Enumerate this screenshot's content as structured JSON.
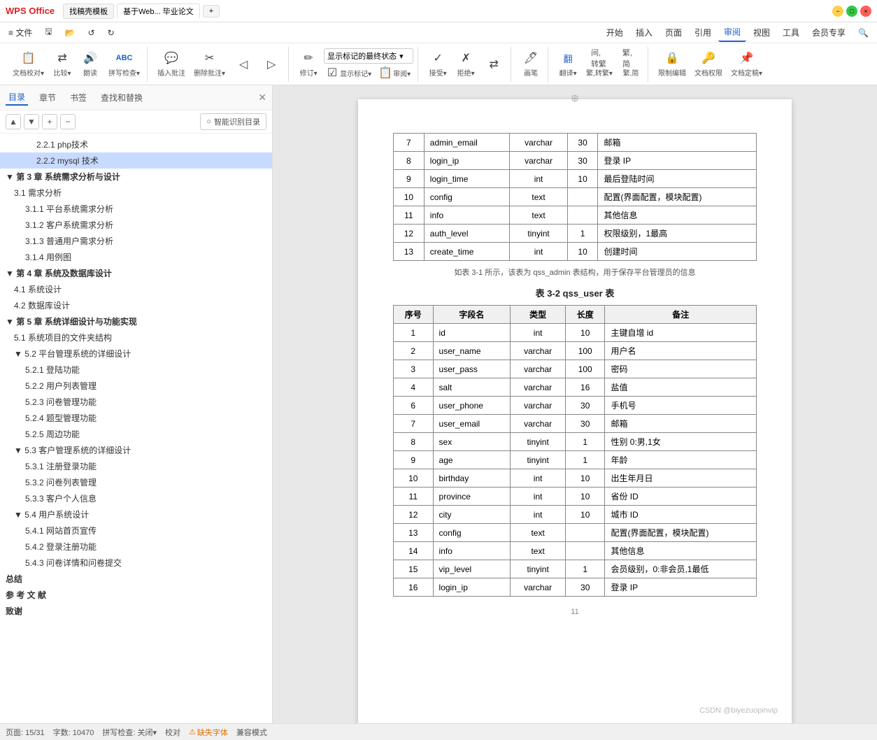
{
  "titleBar": {
    "wpsLabel": "WPS Office",
    "tabs": [
      {
        "label": "找稿壳模板",
        "active": false
      },
      {
        "label": "基于Web... 毕业论文",
        "active": true
      }
    ],
    "addTabLabel": "+",
    "moreLabel": "···"
  },
  "menuBar": {
    "items": [
      {
        "label": "≡ 文件",
        "active": false
      },
      {
        "label": "日",
        "active": false
      },
      {
        "label": "↺",
        "active": false
      },
      {
        "label": "✏",
        "active": false
      },
      {
        "label": "◁",
        "active": false
      },
      {
        "label": "▷",
        "active": false
      },
      {
        "label": "开始",
        "active": false
      },
      {
        "label": "插入",
        "active": false
      },
      {
        "label": "页面",
        "active": false
      },
      {
        "label": "引用",
        "active": false
      },
      {
        "label": "审阅",
        "active": true
      },
      {
        "label": "视图",
        "active": false
      },
      {
        "label": "工具",
        "active": false
      },
      {
        "label": "会员专享",
        "active": false
      },
      {
        "label": "🔍",
        "active": false
      }
    ]
  },
  "toolbar": {
    "groups": [
      {
        "name": "review-group1",
        "buttons": [
          {
            "id": "doc-check",
            "icon": "📋",
            "label": "文档校对▾"
          },
          {
            "id": "compare",
            "icon": "⇄",
            "label": "比较▾"
          },
          {
            "id": "read-aloud",
            "icon": "🔊",
            "label": "朗读"
          },
          {
            "id": "spell-check",
            "icon": "ABC",
            "label": "拼写检查▾"
          }
        ]
      },
      {
        "name": "comment-group",
        "buttons": [
          {
            "id": "insert-comment",
            "icon": "💬",
            "label": "插入批注"
          },
          {
            "id": "delete-comment",
            "icon": "🗑",
            "label": "删除批注▾"
          },
          {
            "id": "nav-comment",
            "icon": "◁▷",
            "label": ""
          }
        ]
      },
      {
        "name": "track-group",
        "buttons": [
          {
            "id": "track-changes",
            "icon": "✏",
            "label": "修订▾"
          },
          {
            "id": "display-mode",
            "icon": "",
            "label": "显示标记的最终状态▾",
            "isDropdown": true
          },
          {
            "id": "show-markup",
            "icon": "☑",
            "label": "显示标记▾"
          },
          {
            "id": "review-pane",
            "icon": "📋",
            "label": "审阅▾"
          }
        ]
      },
      {
        "name": "accept-group",
        "buttons": [
          {
            "id": "accept",
            "icon": "✓",
            "label": "接受▾"
          },
          {
            "id": "reject",
            "icon": "✗",
            "label": "拒绝▾"
          },
          {
            "id": "compare2",
            "icon": "⇄",
            "label": ""
          }
        ]
      },
      {
        "name": "paint-group",
        "buttons": [
          {
            "id": "paint-brush",
            "icon": "🖊",
            "label": "画笔"
          }
        ]
      },
      {
        "name": "translate-group",
        "buttons": [
          {
            "id": "translate",
            "icon": "翻",
            "label": "翻译▾"
          },
          {
            "id": "trad-simp",
            "icon": "繁",
            "label": "繁,转繁▾"
          },
          {
            "id": "simp",
            "icon": "简",
            "label": "繁,简"
          }
        ]
      },
      {
        "name": "restrict-group",
        "buttons": [
          {
            "id": "restrict-edit",
            "icon": "🔒",
            "label": "限制编辑"
          },
          {
            "id": "doc-permission",
            "icon": "🔑",
            "label": "文档权限"
          },
          {
            "id": "doc-finalize",
            "icon": "📌",
            "label": "文档定稿▾"
          }
        ]
      }
    ]
  },
  "toc": {
    "tabs": [
      "目录",
      "章节",
      "书签",
      "查找和替换"
    ],
    "activeTab": "目录",
    "controls": [
      "▲",
      "▼",
      "+",
      "−"
    ],
    "smartTocLabel": "智能识别目录",
    "items": [
      {
        "label": "2.2.1 php技术",
        "level": 4,
        "selected": false
      },
      {
        "label": "2.2.2 mysql 技术",
        "level": 4,
        "selected": true
      },
      {
        "label": "第 3 章 系统需求分析与设计",
        "level": 1,
        "selected": false
      },
      {
        "label": "3.1 需求分析",
        "level": 2,
        "selected": false
      },
      {
        "label": "3.1.1 平台系统需求分析",
        "level": 3,
        "selected": false
      },
      {
        "label": "3.1.2 客户系统需求分析",
        "level": 3,
        "selected": false
      },
      {
        "label": "3.1.3 普通用户需求分析",
        "level": 3,
        "selected": false
      },
      {
        "label": "3.1.4 用例图",
        "level": 3,
        "selected": false
      },
      {
        "label": "第 4 章 系统及数据库设计",
        "level": 1,
        "selected": false
      },
      {
        "label": "4.1 系统设计",
        "level": 2,
        "selected": false
      },
      {
        "label": "4.2 数据库设计",
        "level": 2,
        "selected": false
      },
      {
        "label": "第 5 章 系统详细设计与功能实现",
        "level": 1,
        "selected": false
      },
      {
        "label": "5.1  系统项目的文件夹结构",
        "level": 2,
        "selected": false
      },
      {
        "label": "5.2 平台管理系统的详细设计",
        "level": 2,
        "selected": false
      },
      {
        "label": "5.2.1 登陆功能",
        "level": 3,
        "selected": false
      },
      {
        "label": "5.2.2 用户列表管理",
        "level": 3,
        "selected": false
      },
      {
        "label": "5.2.3 问卷管理功能",
        "level": 3,
        "selected": false
      },
      {
        "label": "5.2.4 题型管理功能",
        "level": 3,
        "selected": false
      },
      {
        "label": "5.2.5 周边功能",
        "level": 3,
        "selected": false
      },
      {
        "label": "5.3 客户管理系统的详细设计",
        "level": 2,
        "selected": false
      },
      {
        "label": "5.3.1 注册登录功能",
        "level": 3,
        "selected": false
      },
      {
        "label": "5.3.2 问卷列表管理",
        "level": 3,
        "selected": false
      },
      {
        "label": "5.3.3 客户个人信息",
        "level": 3,
        "selected": false
      },
      {
        "label": "5.4 用户系统设计",
        "level": 2,
        "selected": false
      },
      {
        "label": "5.4.1 网站首页宣传",
        "level": 3,
        "selected": false
      },
      {
        "label": "5.4.2 登录注册功能",
        "level": 3,
        "selected": false
      },
      {
        "label": "5.4.3 问卷详情和问卷提交",
        "level": 3,
        "selected": false
      },
      {
        "label": "总结",
        "level": 1,
        "selected": false
      },
      {
        "label": "参 考 文 献",
        "level": 1,
        "selected": false
      },
      {
        "label": "致谢",
        "level": 1,
        "selected": false
      }
    ]
  },
  "document": {
    "table1": {
      "rows": [
        {
          "seq": "7",
          "field": "admin_email",
          "type": "varchar",
          "length": "30",
          "note": "邮箱"
        },
        {
          "seq": "8",
          "field": "login_ip",
          "type": "varchar",
          "length": "30",
          "note": "登录 IP"
        },
        {
          "seq": "9",
          "field": "login_time",
          "type": "int",
          "length": "10",
          "note": "最后登陆时间"
        },
        {
          "seq": "10",
          "field": "config",
          "type": "text",
          "length": "",
          "note": "配置(界面配置，模块配置)"
        },
        {
          "seq": "11",
          "field": "info",
          "type": "text",
          "length": "",
          "note": "其他信息"
        },
        {
          "seq": "12",
          "field": "auth_level",
          "type": "tinyint",
          "length": "1",
          "note": "权限级别，1最高"
        },
        {
          "seq": "13",
          "field": "create_time",
          "type": "int",
          "length": "10",
          "note": "创建时间"
        }
      ],
      "note": "如表 3-1 所示，该表为 qss_admin 表结构，用于保存平台管理员的信息"
    },
    "table2": {
      "caption": "表 3-2  qss_user 表",
      "headers": [
        "序号",
        "字段名",
        "类型",
        "长度",
        "备注"
      ],
      "rows": [
        {
          "seq": "1",
          "field": "id",
          "type": "int",
          "length": "10",
          "note": "主键自增 id"
        },
        {
          "seq": "2",
          "field": "user_name",
          "type": "varchar",
          "length": "100",
          "note": "用户名"
        },
        {
          "seq": "3",
          "field": "user_pass",
          "type": "varchar",
          "length": "100",
          "note": "密码"
        },
        {
          "seq": "4",
          "field": "salt",
          "type": "varchar",
          "length": "16",
          "note": "盐值"
        },
        {
          "seq": "6",
          "field": "user_phone",
          "type": "varchar",
          "length": "30",
          "note": "手机号"
        },
        {
          "seq": "7",
          "field": "user_email",
          "type": "varchar",
          "length": "30",
          "note": "邮箱"
        },
        {
          "seq": "8",
          "field": "sex",
          "type": "tinyint",
          "length": "1",
          "note": "性别 0:男,1女"
        },
        {
          "seq": "9",
          "field": "age",
          "type": "tinyint",
          "length": "1",
          "note": "年龄"
        },
        {
          "seq": "10",
          "field": "birthday",
          "type": "int",
          "length": "10",
          "note": "出生年月日"
        },
        {
          "seq": "11",
          "field": "province",
          "type": "int",
          "length": "10",
          "note": "省份 ID"
        },
        {
          "seq": "12",
          "field": "city",
          "type": "int",
          "length": "10",
          "note": "城市 ID"
        },
        {
          "seq": "13",
          "field": "config",
          "type": "text",
          "length": "",
          "note": "配置(界面配置，模块配置)"
        },
        {
          "seq": "14",
          "field": "info",
          "type": "text",
          "length": "",
          "note": "其他信息"
        },
        {
          "seq": "15",
          "field": "vip_level",
          "type": "tinyint",
          "length": "1",
          "note": "会员级别，0:非会员,1最低"
        },
        {
          "seq": "16",
          "field": "login_ip",
          "type": "varchar",
          "length": "30",
          "note": "登录 IP"
        }
      ]
    },
    "pageNumber": "11"
  },
  "statusBar": {
    "page": "页面: 15/31",
    "wordCount": "字数: 10470",
    "spellCheck": "拼写检查: 关闭▾",
    "proofreading": "校对",
    "missingFont": "缺失字体",
    "compatMode": "兼容模式",
    "watermark": "CSDN @biyezuopinvip"
  }
}
